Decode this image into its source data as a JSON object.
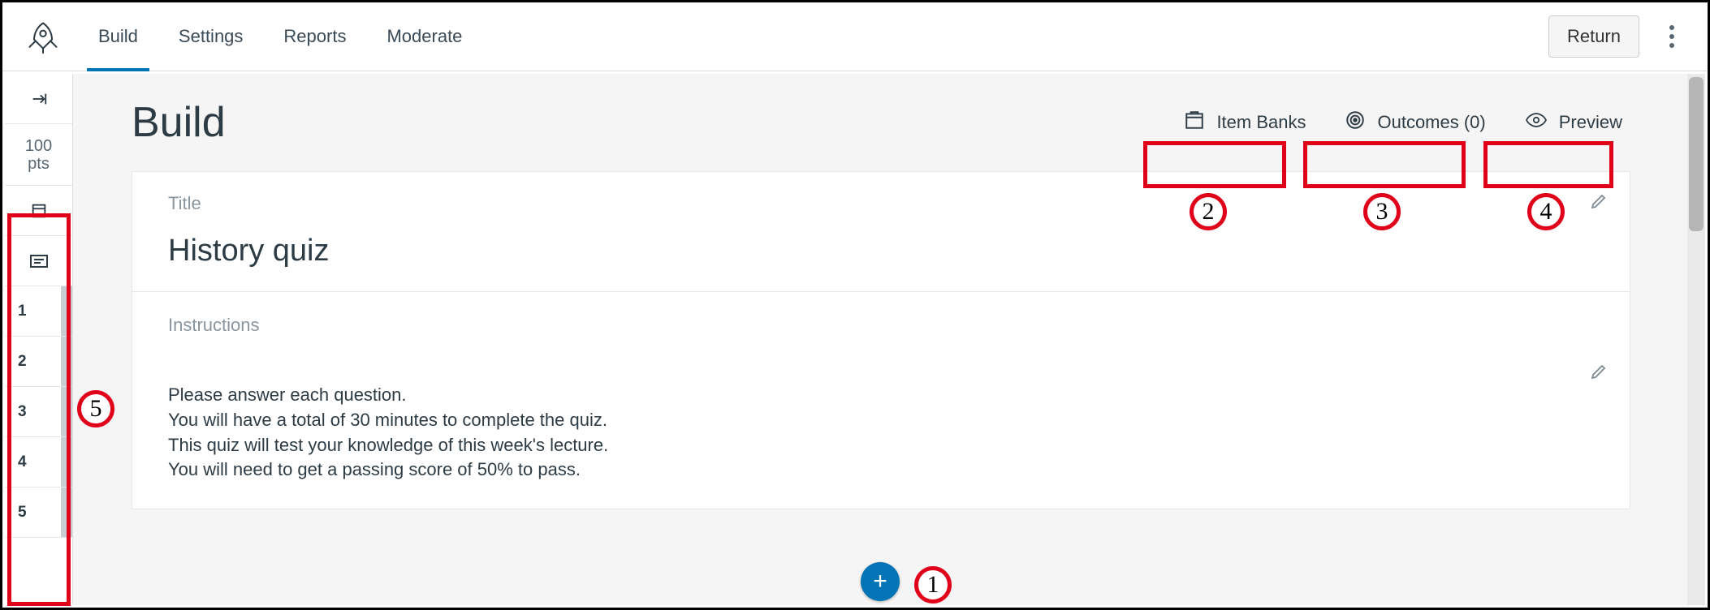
{
  "header": {
    "tabs": [
      "Build",
      "Settings",
      "Reports",
      "Moderate"
    ],
    "active_tab_index": 0,
    "return_label": "Return"
  },
  "sidebar": {
    "points_value": "100",
    "points_label": "pts",
    "question_numbers": [
      "1",
      "2",
      "3",
      "4",
      "5"
    ]
  },
  "page": {
    "title": "Build",
    "actions": {
      "item_banks_label": "Item Banks",
      "outcomes_label": "Outcomes (0)",
      "preview_label": "Preview"
    }
  },
  "quiz": {
    "title_label": "Title",
    "title": "History quiz",
    "instructions_label": "Instructions",
    "instructions_lines": [
      "Please answer each question.",
      "You will have a total of 30 minutes to complete the quiz.",
      "This quiz will test your knowledge of this week's lecture.",
      "You will need to get a passing score of 50% to pass."
    ]
  },
  "annotations": {
    "a1": "1",
    "a2": "2",
    "a3": "3",
    "a4": "4",
    "a5": "5"
  }
}
